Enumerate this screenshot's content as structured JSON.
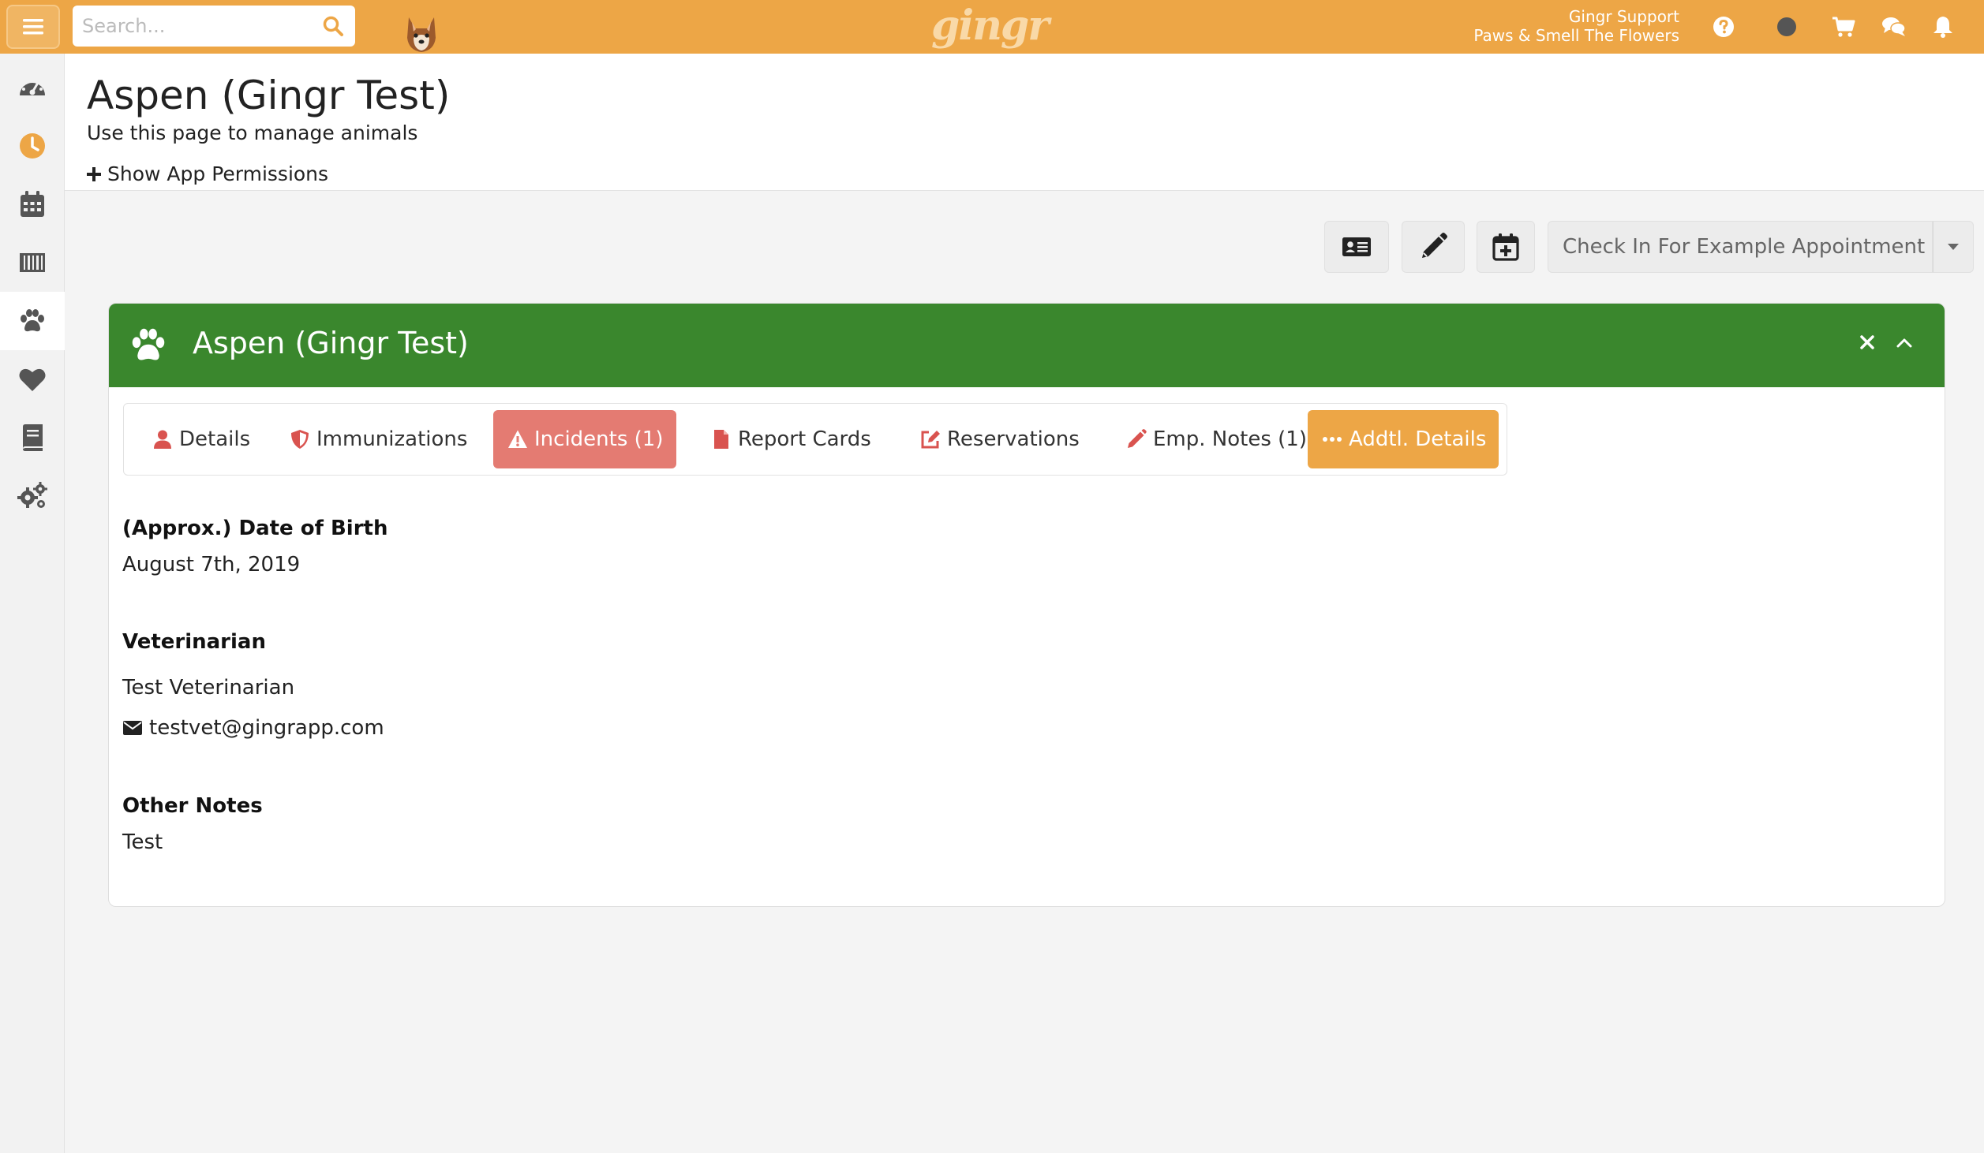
{
  "topbar": {
    "search_placeholder": "Search...",
    "logo_text": "gingr",
    "user_name": "Gingr Support",
    "location": "Paws & Smell The Flowers",
    "icons": [
      "help-icon",
      "status-dot-icon",
      "cart-icon",
      "chat-icon",
      "bell-icon"
    ]
  },
  "sidebar": {
    "items": [
      {
        "name": "dashboard-icon"
      },
      {
        "name": "clock-icon"
      },
      {
        "name": "calendar-icon"
      },
      {
        "name": "barcode-icon"
      },
      {
        "name": "paw-icon"
      },
      {
        "name": "heart-icon"
      },
      {
        "name": "book-icon"
      },
      {
        "name": "cogs-icon"
      }
    ]
  },
  "page": {
    "title": "Aspen (Gingr Test)",
    "subtitle": "Use this page to manage animals",
    "permissions_link": "Show App Permissions"
  },
  "actions": {
    "checkin_label": "Check In For Example Appointment"
  },
  "panel": {
    "title": "Aspen (Gingr Test)",
    "tabs": [
      {
        "label": "Details"
      },
      {
        "label": "Immunizations"
      },
      {
        "label": "Incidents (1)"
      },
      {
        "label": "Report Cards"
      },
      {
        "label": "Reservations"
      },
      {
        "label": "Emp. Notes (1)"
      },
      {
        "label": "Addtl. Details"
      }
    ],
    "fields": {
      "dob_label": "(Approx.) Date of Birth",
      "dob_value": "August 7th, 2019",
      "vet_label": "Veterinarian",
      "vet_name": "Test Veterinarian",
      "vet_email": "testvet@gingrapp.com",
      "notes_label": "Other Notes",
      "notes_value": "Test"
    }
  },
  "colors": {
    "topbar": "#eda646",
    "panel_header": "#3a872d",
    "incidents_tab": "#e47b72",
    "addtl_tab": "#eda646",
    "accent_red": "#d9534f"
  }
}
